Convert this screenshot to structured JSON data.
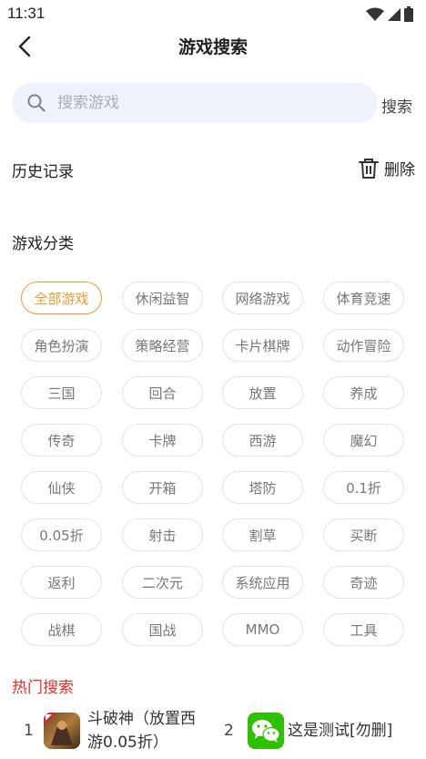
{
  "status_bar": {
    "time": "11:31"
  },
  "header": {
    "title": "游戏搜索"
  },
  "search": {
    "placeholder": "搜索游戏",
    "button_label": "搜索"
  },
  "history": {
    "title": "历史记录",
    "delete_label": "删除"
  },
  "categories": {
    "title": "游戏分类",
    "active_index": 0,
    "items": [
      "全部游戏",
      "休闲益智",
      "网络游戏",
      "体育竞速",
      "角色扮演",
      "策略经营",
      "卡片棋牌",
      "动作冒险",
      "三国",
      "回合",
      "放置",
      "养成",
      "传奇",
      "卡牌",
      "西游",
      "魔幻",
      "仙侠",
      "开箱",
      "塔防",
      "0.1折",
      "0.05折",
      "射击",
      "割草",
      "买断",
      "返利",
      "二次元",
      "系统应用",
      "奇迹",
      "战棋",
      "国战",
      "MMO",
      "工具"
    ]
  },
  "hot_search": {
    "title": "热门搜索",
    "items": [
      {
        "rank": "1",
        "name_line1": "斗破神（放置西",
        "name_line2": "游0.05折）",
        "icon": "game-warrior-icon"
      },
      {
        "rank": "2",
        "name_line1": "这是测试[勿删]",
        "name_line2": "",
        "icon": "wechat-icon"
      }
    ]
  },
  "colors": {
    "accent": "#f39a33",
    "hot_title": "#e8302a",
    "search_bg": "#eef2fa",
    "tag_border": "#e3e3e3",
    "wechat_green": "#2dc100"
  }
}
